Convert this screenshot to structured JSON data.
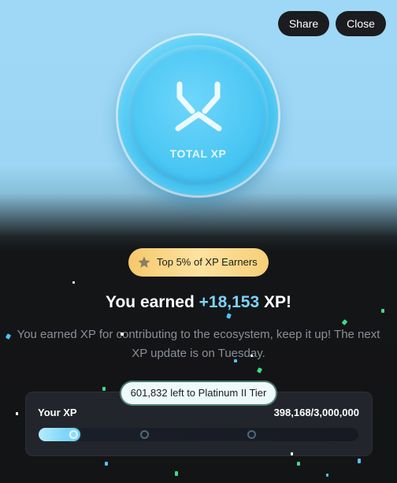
{
  "header": {
    "share_label": "Share",
    "close_label": "Close"
  },
  "coin": {
    "label": "TOTAL XP",
    "icon": "xp-logo-icon"
  },
  "badge": {
    "icon": "star-icon",
    "text": "Top 5% of XP Earners"
  },
  "headline": {
    "prefix": "You earned ",
    "amount": "+18,153",
    "suffix": " XP!"
  },
  "description": "You earned XP for contributing to the ecosystem, keep it up! The next XP update is on Tuesday.",
  "progress": {
    "remaining_text": "601,832 left to Platinum II Tier",
    "label": "Your XP",
    "value_text": "398,168/3,000,000",
    "current": 398168,
    "goal": 3000000,
    "fill_fraction": 0.13
  },
  "colors": {
    "accent": "#7cd3f7",
    "badge_gold": "#f6c86a",
    "background_dark": "#131416",
    "sky": "#9fd8f6"
  }
}
